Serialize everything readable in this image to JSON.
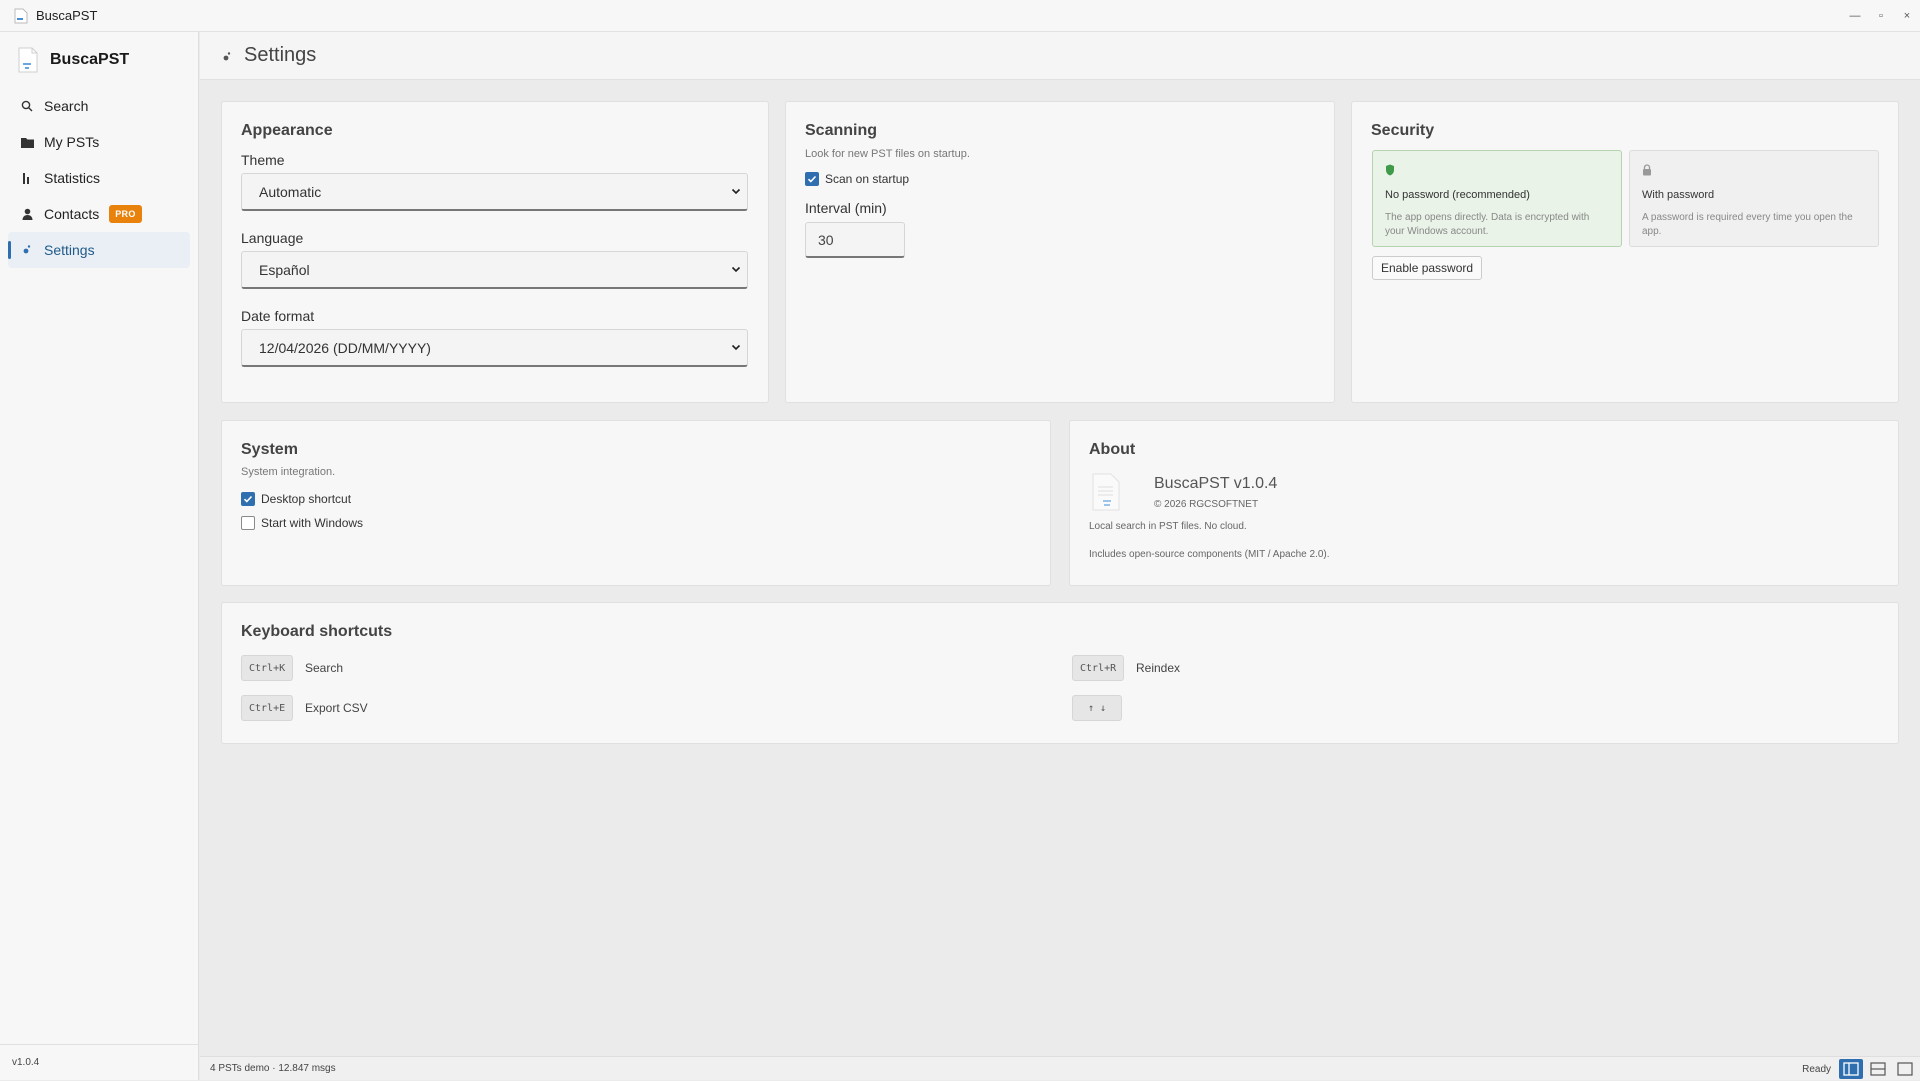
{
  "window": {
    "title": "BuscaPST",
    "controls": {
      "minimize": "—",
      "maximize": "▫",
      "close": "×"
    }
  },
  "sidebar": {
    "brand": "BuscaPST",
    "items": [
      {
        "label": "Search",
        "icon": "search-icon"
      },
      {
        "label": "My PSTs",
        "icon": "folder-icon"
      },
      {
        "label": "Statistics",
        "icon": "bar-chart-icon"
      },
      {
        "label": "Contacts",
        "icon": "person-icon",
        "badge": "PRO"
      },
      {
        "label": "Settings",
        "icon": "gear-icon",
        "active": true
      }
    ],
    "version": "v1.0.4"
  },
  "header": {
    "title": "Settings"
  },
  "appearance": {
    "title": "Appearance",
    "theme_label": "Theme",
    "theme_value": "Automatic",
    "language_label": "Language",
    "language_value": "Español",
    "date_label": "Date format",
    "date_value": "12/04/2026 (DD/MM/YYYY)"
  },
  "scanning": {
    "title": "Scanning",
    "subtitle": "Look for new PST files on startup.",
    "scan_on_startup_label": "Scan on startup",
    "scan_on_startup_checked": true,
    "interval_label": "Interval (min)",
    "interval_value": "30"
  },
  "security": {
    "title": "Security",
    "options": [
      {
        "title": "No password (recommended)",
        "desc": "The app opens directly. Data is encrypted with your Windows account.",
        "icon": "shield-icon",
        "selected": true
      },
      {
        "title": "With password",
        "desc": "A password is required every time you open the app.",
        "icon": "lock-icon",
        "selected": false
      }
    ],
    "enable_button": "Enable password"
  },
  "system": {
    "title": "System",
    "subtitle": "System integration.",
    "desktop_shortcut_label": "Desktop shortcut",
    "desktop_shortcut_checked": true,
    "start_with_windows_label": "Start with Windows",
    "start_with_windows_checked": false
  },
  "about": {
    "title": "About",
    "name": "BuscaPST v1.0.4",
    "copyright": "© 2026 RGCSOFTNET",
    "description": "Local search in PST files. No cloud.",
    "license": "Includes open-source components (MIT / Apache 2.0)."
  },
  "shortcuts": {
    "title": "Keyboard shortcuts",
    "items": [
      {
        "key": "Ctrl+K",
        "label": "Search"
      },
      {
        "key": "Ctrl+R",
        "label": "Reindex"
      },
      {
        "key": "Ctrl+E",
        "label": "Export CSV"
      },
      {
        "key": "↑ ↓",
        "label": ""
      }
    ]
  },
  "statusbar": {
    "left": "4 PSTs demo · 12.847 msgs",
    "ready": "Ready"
  },
  "colors": {
    "accent": "#2f6fb0",
    "pro_badge": "#e8820c",
    "secure_option_bg": "#e9f3e7",
    "shield": "#3f9a4a"
  }
}
